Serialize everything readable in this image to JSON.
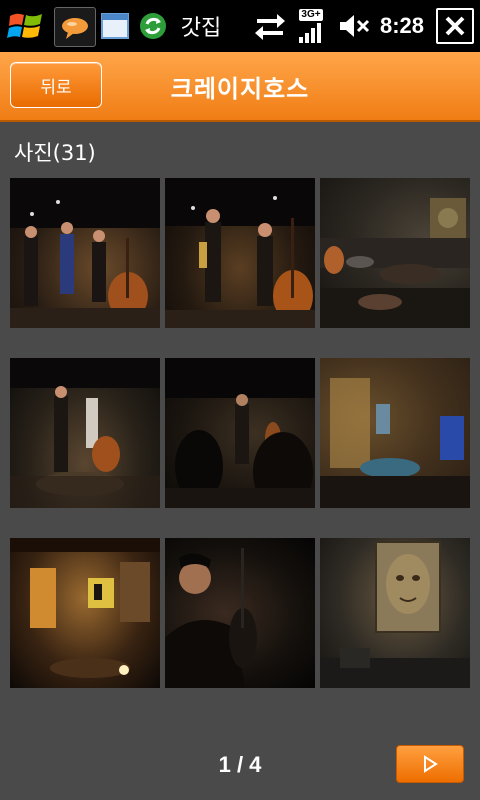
{
  "status_bar": {
    "app_name": "갓집",
    "network_label": "3G+",
    "time": "8:28",
    "icons": [
      "windows-start-icon",
      "chat-app-icon",
      "window-app-icon",
      "sync-app-icon",
      "data-transfer-icon",
      "signal-icon",
      "speaker-muted-icon",
      "close-icon"
    ]
  },
  "header": {
    "back_label": "뒤로",
    "title": "크레이지호스"
  },
  "gallery": {
    "section_title": "사진(31)",
    "photos": [
      {
        "description_icon": "jazz-band-photo"
      },
      {
        "description_icon": "jazz-band-photo"
      },
      {
        "description_icon": "club-interior-photo"
      },
      {
        "description_icon": "jazz-band-photo"
      },
      {
        "description_icon": "jazz-band-photo"
      },
      {
        "description_icon": "club-interior-photo"
      },
      {
        "description_icon": "club-interior-photo"
      },
      {
        "description_icon": "bassist-photo"
      },
      {
        "description_icon": "painting-photo"
      }
    ]
  },
  "pagination": {
    "page_text": "1 / 4",
    "next_icon": "play-next-icon"
  },
  "colors": {
    "accent": "#f07d14",
    "background": "#4a4a4a",
    "status_bar": "#000000"
  }
}
